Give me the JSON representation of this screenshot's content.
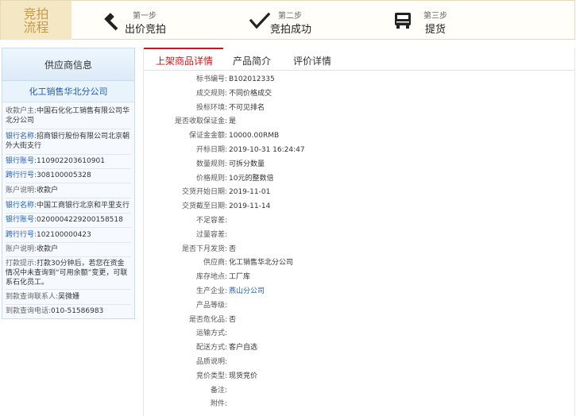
{
  "process": {
    "title": "竞拍流程",
    "steps": [
      {
        "small": "第一步",
        "big": "出价竞拍",
        "icon": "gavel-icon"
      },
      {
        "small": "第二步",
        "big": "竞拍成功",
        "icon": "checkmark-icon"
      },
      {
        "small": "第三步",
        "big": "提货",
        "icon": "truck-icon"
      }
    ]
  },
  "supplier": {
    "header": "供应商信息",
    "company": "化工销售华北分公司",
    "rows": [
      {
        "k": "收款户主:",
        "v": "中国石化化工销售有限公司华北分公司",
        "blue": false
      },
      {
        "k": "银行名称:",
        "v": "招商银行股份有限公司北京朝外大街支行",
        "blue": true
      },
      {
        "k": "银行账号:",
        "v": "110902203610901",
        "blue": true
      },
      {
        "k": "跨行行号:",
        "v": "308100005328",
        "blue": true
      },
      {
        "k": "账户说明:",
        "v": "收款户",
        "blue": false
      },
      {
        "k": "银行名称:",
        "v": "中国工商银行北京和平里支行",
        "blue": true
      },
      {
        "k": "银行账号:",
        "v": "0200004229200158518",
        "blue": true
      },
      {
        "k": "跨行行号:",
        "v": "102100000423",
        "blue": true
      },
      {
        "k": "账户说明:",
        "v": "收款户",
        "blue": false
      },
      {
        "k": "打款提示:",
        "v": "打款30分钟后，若您在资金情况中未查询到“可用余额”变更，可联系石化员工。",
        "blue": false
      },
      {
        "k": "到款查询联系人:",
        "v": "吴微姗",
        "blue": false
      },
      {
        "k": "到款查询电话:",
        "v": "010-51586983",
        "blue": false
      }
    ]
  },
  "tabs": [
    "上架商品详情",
    "产品简介",
    "评价详情"
  ],
  "details": [
    {
      "k": "标书编号:",
      "v": "B102012335"
    },
    {
      "k": "成交规则:",
      "v": "不同价格成交"
    },
    {
      "k": "投标环境:",
      "v": "不可见排名"
    },
    {
      "k": "是否收取保证金:",
      "v": "是"
    },
    {
      "k": "保证金金额:",
      "v": "10000.00RMB"
    },
    {
      "k": "开标日期:",
      "v": "2019-10-31 16:24:47"
    },
    {
      "k": "数量规则:",
      "v": "可拆分数量"
    },
    {
      "k": "价格规则:",
      "v": "10元的整数倍"
    },
    {
      "k": "交货开始日期:",
      "v": "2019-11-01"
    },
    {
      "k": "交货截至日期:",
      "v": "2019-11-14"
    },
    {
      "k": "不足容差:",
      "v": ""
    },
    {
      "k": "过量容差:",
      "v": ""
    },
    {
      "k": "是否下月发货:",
      "v": "否"
    },
    {
      "k": "供应商:",
      "v": "化工销售华北分公司"
    },
    {
      "k": "库存地点:",
      "v": "工厂库"
    },
    {
      "k": "生产企业:",
      "v": "燕山分公司"
    },
    {
      "k": "产品等级:",
      "v": ""
    },
    {
      "k": "是否危化品:",
      "v": "否"
    },
    {
      "k": "运输方式:",
      "v": ""
    },
    {
      "k": "配送方式:",
      "v": "客户自选"
    },
    {
      "k": "品质说明:",
      "v": ""
    },
    {
      "k": "竞价类型:",
      "v": "现货竞价"
    },
    {
      "k": "备注:",
      "v": ""
    },
    {
      "k": "附件:",
      "v": ""
    }
  ]
}
